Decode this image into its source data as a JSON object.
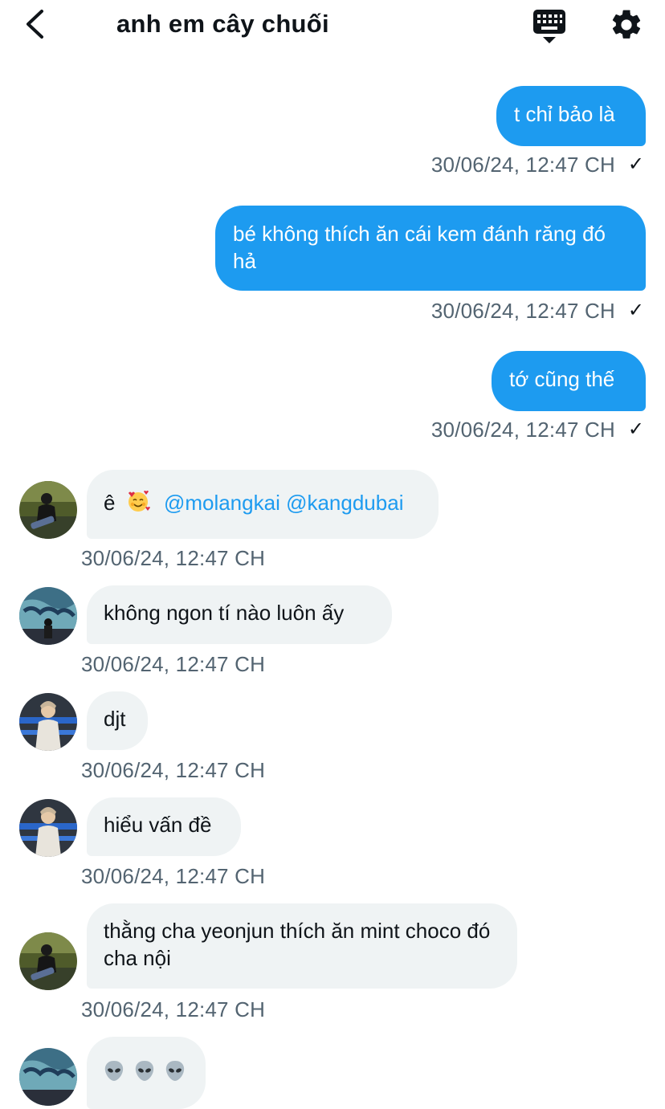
{
  "header": {
    "title": "anh em cây chuối"
  },
  "icons": {
    "back": "chevron-left-icon",
    "keyboard": "keyboard-icon",
    "settings": "gear-icon"
  },
  "colors": {
    "outgoing_bubble": "#1d9bf0",
    "incoming_bubble": "#eff3f4",
    "timestamp": "#536471",
    "mention": "#1d9bf0"
  },
  "messages": [
    {
      "direction": "outgoing",
      "text": "t chỉ bảo là",
      "time": "30/06/24, 12:47 CH",
      "read_mark": "✓"
    },
    {
      "direction": "outgoing",
      "text": "bé không thích ăn cái kem đánh răng đó hả",
      "time": "30/06/24, 12:47 CH",
      "read_mark": "✓"
    },
    {
      "direction": "outgoing",
      "text": "tớ cũng thế",
      "time": "30/06/24, 12:47 CH",
      "read_mark": "✓"
    },
    {
      "direction": "incoming",
      "text": "ê",
      "emoji": "smiling-face-with-hearts",
      "mentions": [
        "@molangkai",
        "@kangdubai"
      ],
      "time": "30/06/24, 12:47 CH",
      "avatar": "avatar-a"
    },
    {
      "direction": "incoming",
      "text": "không ngon tí nào luôn ấy",
      "time": "30/06/24, 12:47 CH",
      "avatar": "avatar-b"
    },
    {
      "direction": "incoming",
      "text": "djt",
      "time": "30/06/24, 12:47 CH",
      "avatar": "avatar-c"
    },
    {
      "direction": "incoming",
      "text": "hiểu vấn đề",
      "time": "30/06/24, 12:47 CH",
      "avatar": "avatar-c"
    },
    {
      "direction": "incoming",
      "text": "thằng cha yeonjun thích ăn mint choco đó cha nội",
      "time": "30/06/24, 12:47 CH",
      "avatar": "avatar-a"
    },
    {
      "direction": "incoming",
      "emoji": "alien-emoji x3",
      "time": "",
      "avatar": "avatar-b"
    }
  ]
}
